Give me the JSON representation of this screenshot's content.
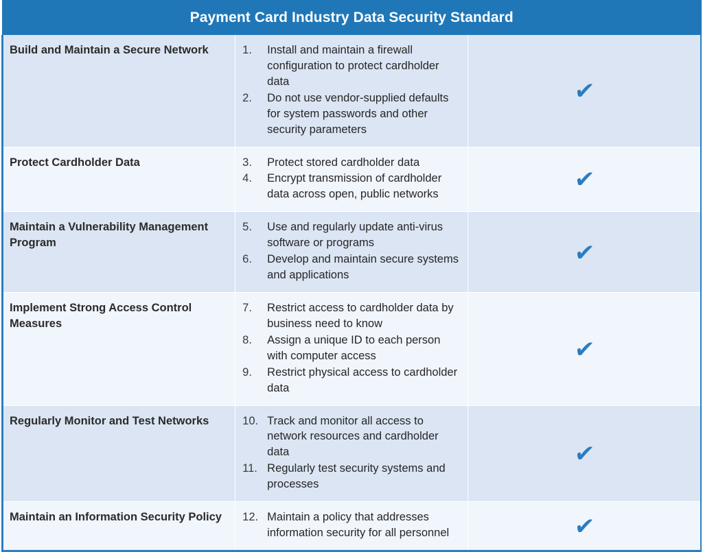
{
  "header": {
    "title": "Payment Card Industry Data Security Standard",
    "bar_color": "#1f77b8",
    "text_color": "#ffffff"
  },
  "style": {
    "border_color": "#2a7fbf",
    "band_a_color": "#dbe5f3",
    "band_b_color": "#f1f5fc",
    "check_color": "#2b7cc0",
    "heading_text_color": "#2b2b2b",
    "body_text_color": "#262626"
  },
  "check_icon": {
    "name": "check-mark-icon",
    "glyph": "✔"
  },
  "rows": [
    {
      "principle": "Build and Maintain a Secure Network",
      "requirements": [
        {
          "num": "1.",
          "text": "Install and maintain a firewall configuration to protect cardholder data"
        },
        {
          "num": "2.",
          "text": "Do not use vendor-supplied defaults for system passwords and other security parameters"
        }
      ],
      "checked": true
    },
    {
      "principle": "Protect Cardholder Data",
      "requirements": [
        {
          "num": "3.",
          "text": "Protect stored cardholder data"
        },
        {
          "num": "4.",
          "text": "Encrypt transmission of cardholder data across open, public networks"
        }
      ],
      "checked": true
    },
    {
      "principle": "Maintain a Vulnerability Management Program",
      "requirements": [
        {
          "num": "5.",
          "text": "Use and regularly update anti-virus software or programs"
        },
        {
          "num": "6.",
          "text": "Develop and maintain secure systems and applications"
        }
      ],
      "checked": true
    },
    {
      "principle": "Implement Strong Access Control Measures",
      "requirements": [
        {
          "num": "7.",
          "text": "Restrict access to cardholder data by business need to know"
        },
        {
          "num": "8.",
          "text": "Assign a unique ID to each person with computer access"
        },
        {
          "num": "9.",
          "text": "Restrict physical access to cardholder data"
        }
      ],
      "checked": true
    },
    {
      "principle": "Regularly Monitor and Test Networks",
      "requirements": [
        {
          "num": "10.",
          "text": "Track and monitor all access to network resources and cardholder data"
        },
        {
          "num": "11.",
          "text": "Regularly test security systems and processes"
        }
      ],
      "checked": true
    },
    {
      "principle": "Maintain an Information Security Policy",
      "requirements": [
        {
          "num": "12.",
          "text": "Maintain a policy that addresses information security for all personnel"
        }
      ],
      "checked": true
    }
  ]
}
